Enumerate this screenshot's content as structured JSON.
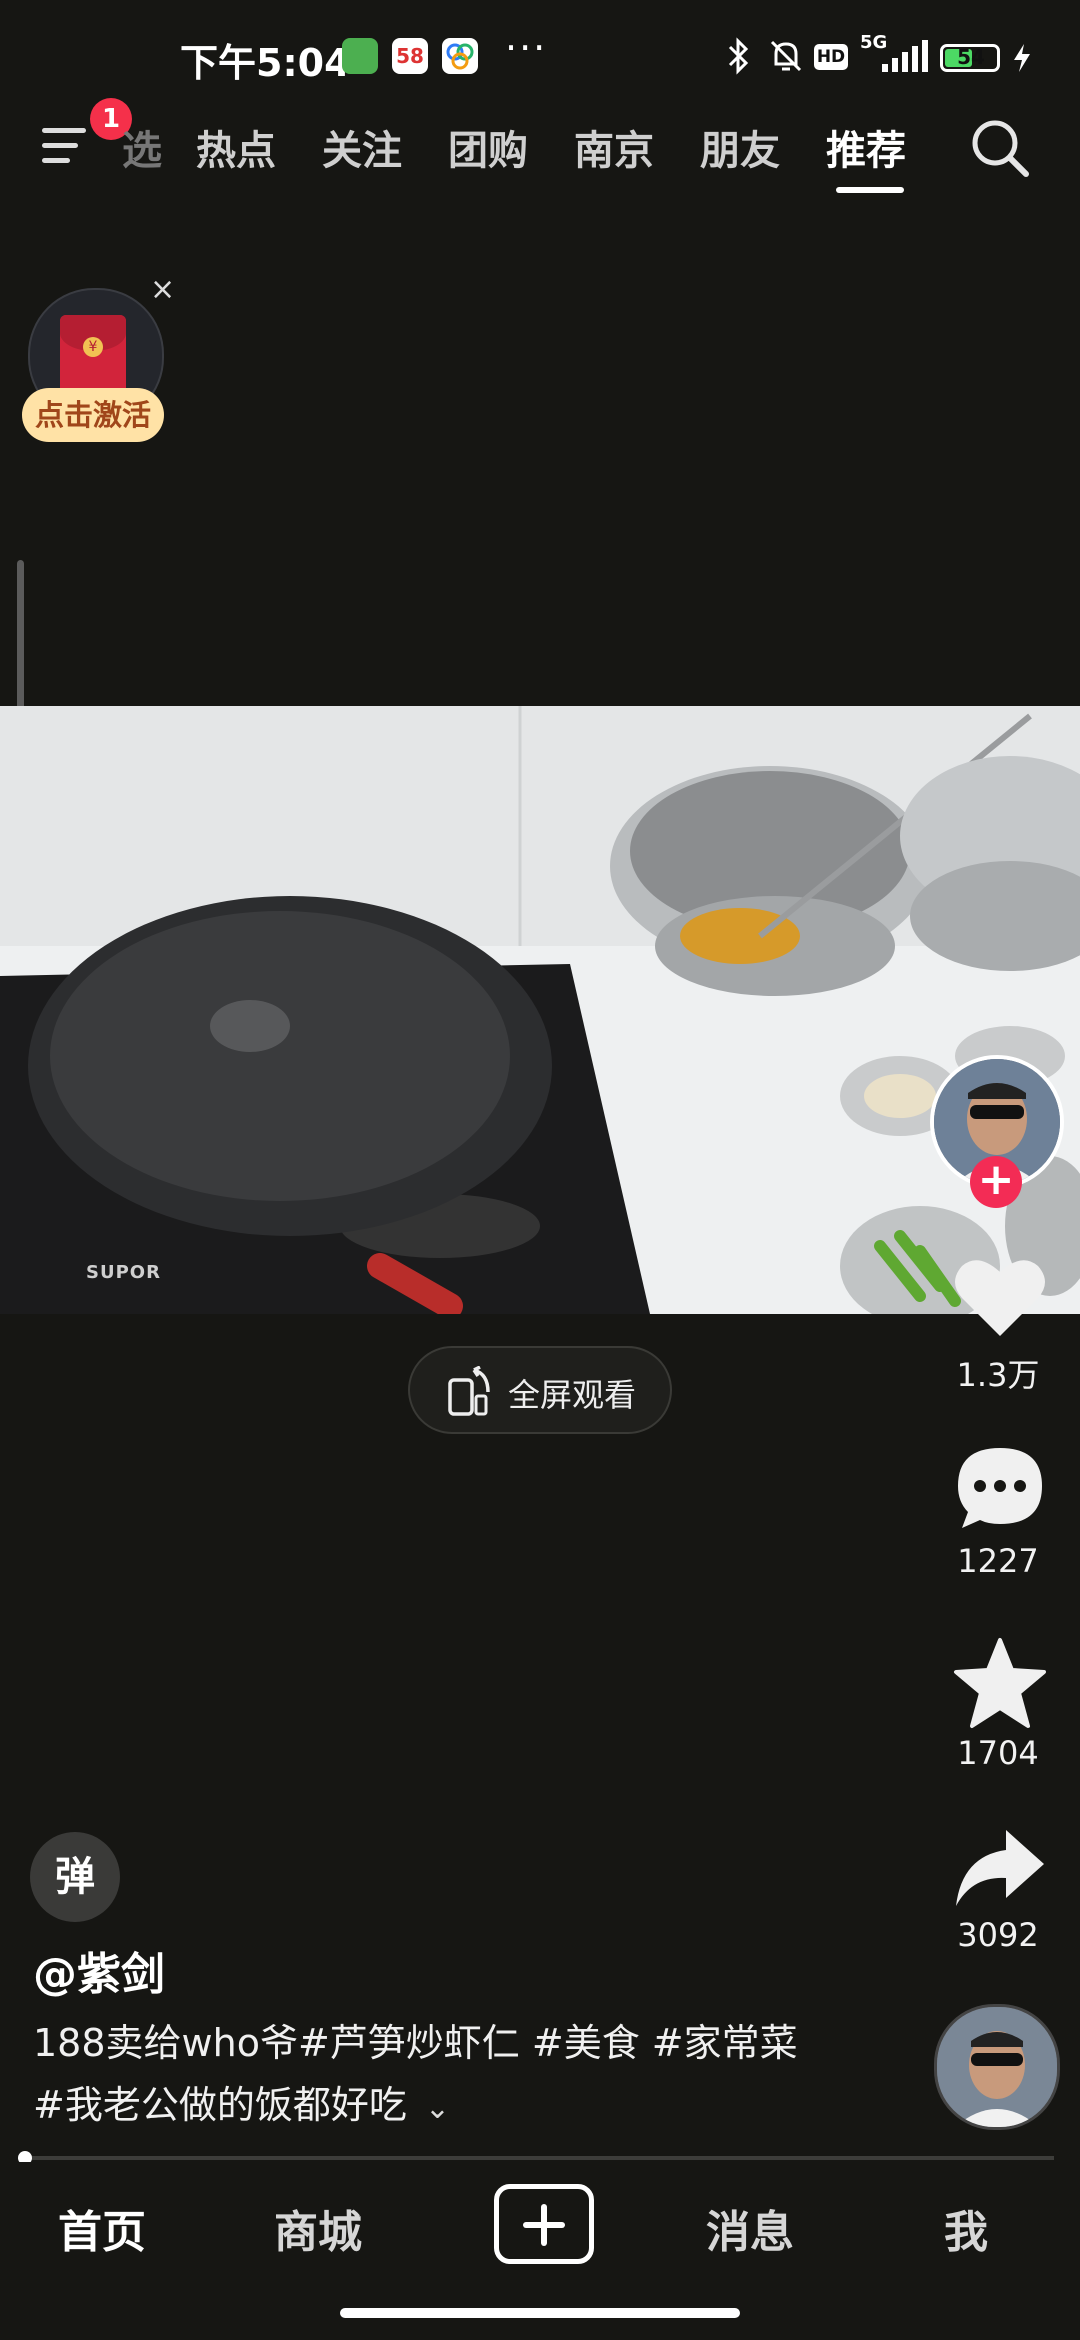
{
  "status_bar": {
    "time": "下午5:04",
    "app_badge_58": "58",
    "more": "···",
    "network": "5G",
    "hd": "HD",
    "battery": "54",
    "battery_level": 0.54
  },
  "top_nav": {
    "notification_count": "1",
    "partial_tab": "选",
    "tabs": [
      "热点",
      "关注",
      "团购",
      "南京",
      "朋友",
      "推荐"
    ],
    "active_tab": "推荐"
  },
  "red_packet": {
    "label": "点击激活",
    "close": "×",
    "coin": "¥"
  },
  "video": {
    "brand": "SUPOR",
    "fullscreen_label": "全屏观看",
    "progress": 0.0
  },
  "actions": {
    "follow_plus": "+",
    "likes": "1.3万",
    "comments": "1227",
    "favorites": "1704",
    "shares": "3092"
  },
  "post": {
    "danmu": "弹",
    "username": "@紫剑",
    "caption": "188卖给who爷#芦笋炒虾仁 #美食 #家常菜 #我老公做的饭都好吃",
    "expand": "⌄"
  },
  "bottom_nav": {
    "items": [
      "首页",
      "商城",
      "消息",
      "我"
    ],
    "active": "首页"
  },
  "colors": {
    "background": "#161613",
    "accent_red": "#f32c55",
    "badge_red": "#f5304a",
    "battery_green": "#4cd964"
  }
}
